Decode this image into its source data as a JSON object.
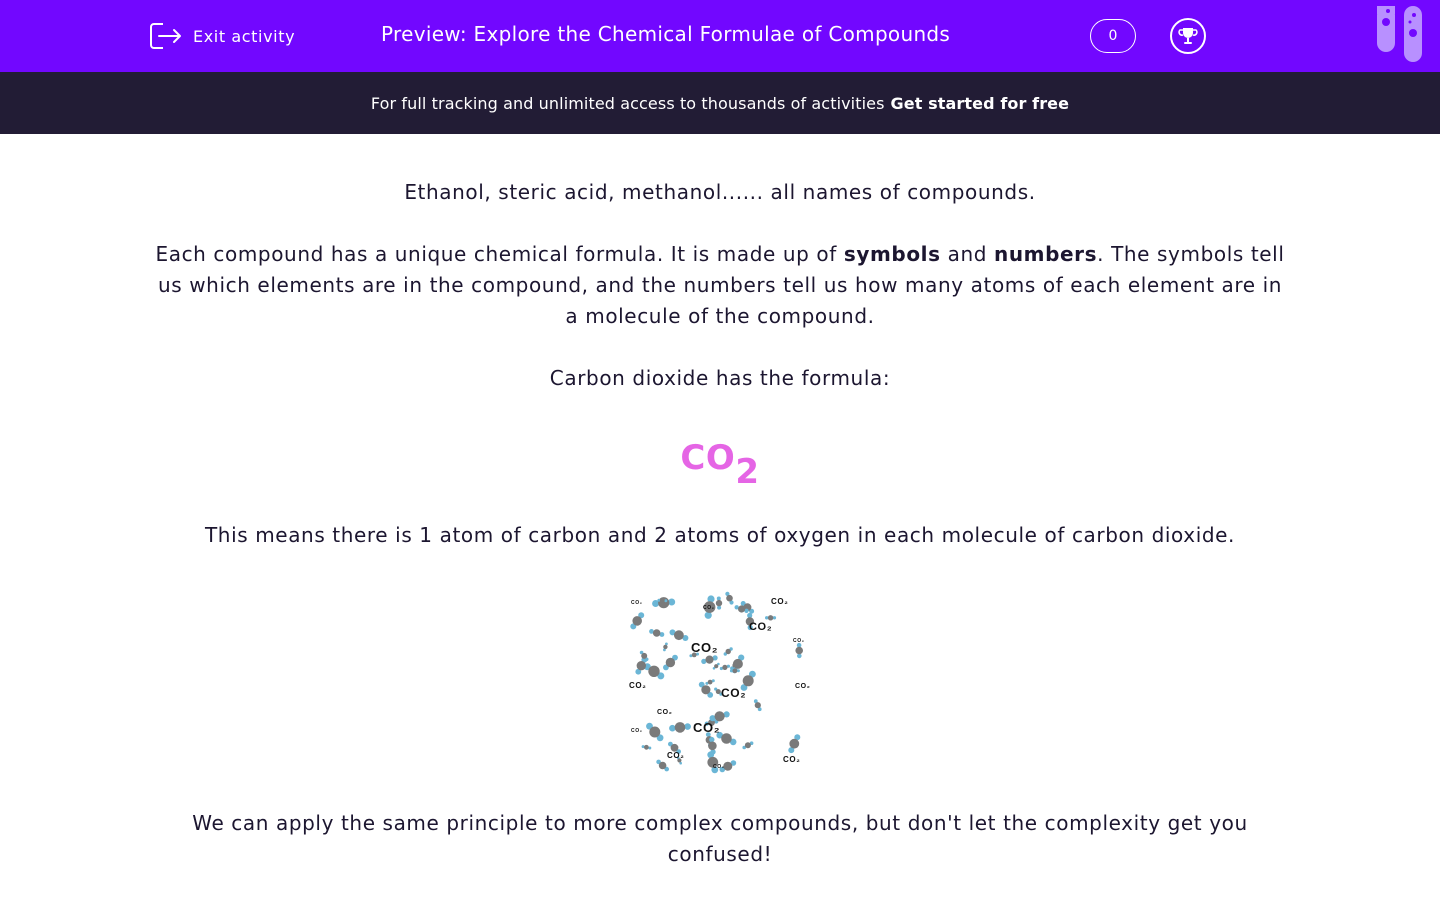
{
  "header": {
    "exit_label": "Exit activity",
    "title": "Preview: Explore the Chemical Formulae of Compounds",
    "score": "0",
    "accent_color": "#7207ff"
  },
  "banner": {
    "text": "For full tracking and unlimited access to thousands of activities",
    "cta": "Get started for free",
    "background": "#221c35"
  },
  "content": {
    "intro": "Ethanol, steric acid, methanol...... all names of compounds.",
    "para2_a": "Each compound has a unique chemical formula. It is made up of ",
    "para2_symbols": "symbols",
    "para2_and": " and ",
    "para2_numbers": "numbers",
    "para2_b": ". The symbols tell us which elements are in the compound, and the numbers tell us how many atoms of each element are in a molecule of the compound.",
    "formula_intro": "Carbon dioxide has the formula:",
    "formula_main": "CO",
    "formula_sub": "2",
    "formula_color": "#e565e5",
    "meaning": "This means there is 1 atom of carbon and 2 atoms of oxygen in each molecule of carbon dioxide.",
    "image_label": "CO₂",
    "closing": "We can apply the same principle to more complex compounds, but don't let the complexity get you confused!"
  }
}
